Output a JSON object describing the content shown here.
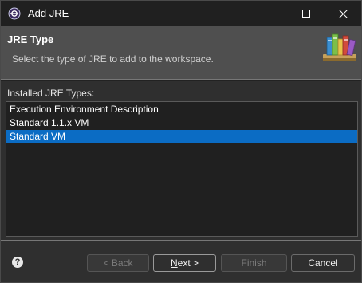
{
  "window": {
    "title": "Add JRE",
    "app_icon": "eclipse-icon",
    "controls": {
      "minimize_icon": "minimize-icon",
      "maximize_icon": "maximize-icon",
      "close_icon": "close-icon"
    }
  },
  "header": {
    "title": "JRE Type",
    "description": "Select the type of JRE to add to the workspace.",
    "graphic": "library-books-icon"
  },
  "list": {
    "label": "Installed JRE Types:",
    "items": [
      {
        "label": "Execution Environment Description",
        "selected": false
      },
      {
        "label": "Standard 1.1.x VM",
        "selected": false
      },
      {
        "label": "Standard VM",
        "selected": true
      }
    ]
  },
  "buttons": {
    "help_icon": "help-icon",
    "back": {
      "label": "< Back",
      "enabled": false
    },
    "next": {
      "label_prefix": "",
      "label_mnemonic": "N",
      "label_rest": "ext >",
      "enabled": true
    },
    "finish": {
      "label": "Finish",
      "enabled": false
    },
    "cancel": {
      "label": "Cancel",
      "enabled": true
    }
  },
  "colors": {
    "titlebar": "#202020",
    "header_bg": "#4f4f4f",
    "dialog_bg": "#2f2f2f",
    "list_bg": "#202020",
    "selection": "#0b6cc4"
  }
}
